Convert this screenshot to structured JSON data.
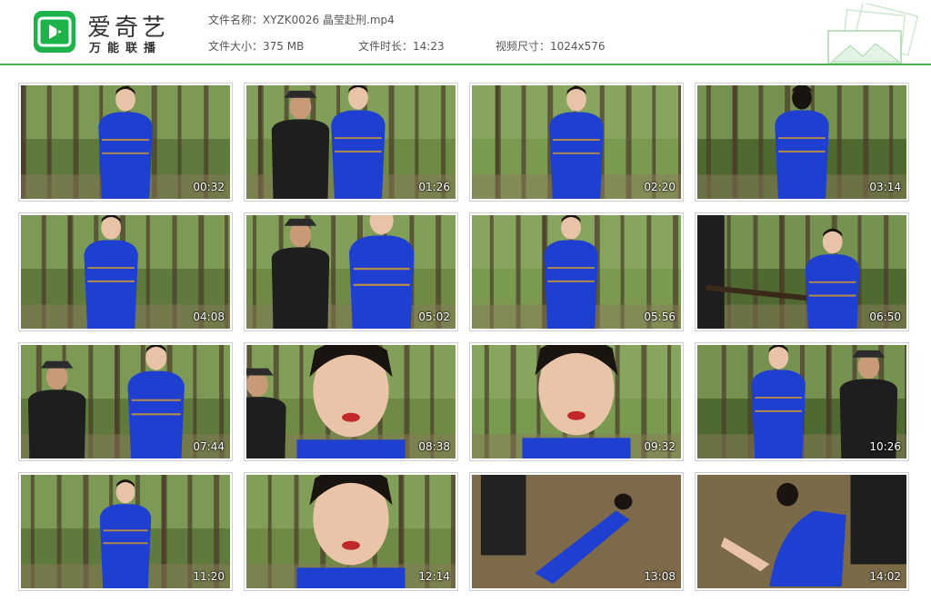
{
  "header": {
    "brand_title": "爱奇艺",
    "brand_subtitle": "万能联播",
    "file_name_label": "文件名称：",
    "file_name": "XYZK0026 晶莹赴刑.mp4",
    "file_size_label": "文件大小：",
    "file_size": "375 MB",
    "duration_label": "文件时长：",
    "duration": "14:23",
    "dimensions_label": "视频尺寸：",
    "dimensions": "1024x576"
  },
  "colors": {
    "accent": "#1db34a",
    "line": "#4caf50",
    "dress": "#1f3fd0"
  },
  "thumbnails": [
    {
      "time": "00:32",
      "scene": "woman-center"
    },
    {
      "time": "01:26",
      "scene": "woman-man-left"
    },
    {
      "time": "02:20",
      "scene": "woman-center"
    },
    {
      "time": "03:14",
      "scene": "woman-back"
    },
    {
      "time": "04:08",
      "scene": "woman-side"
    },
    {
      "time": "05:02",
      "scene": "man-woman-closeup"
    },
    {
      "time": "05:56",
      "scene": "woman-profile"
    },
    {
      "time": "06:50",
      "scene": "rifle-woman"
    },
    {
      "time": "07:44",
      "scene": "man-woman"
    },
    {
      "time": "08:38",
      "scene": "woman-face"
    },
    {
      "time": "09:32",
      "scene": "face-closeup"
    },
    {
      "time": "10:26",
      "scene": "woman-man-right"
    },
    {
      "time": "11:20",
      "scene": "woman-center-far"
    },
    {
      "time": "12:14",
      "scene": "face-closeup"
    },
    {
      "time": "13:08",
      "scene": "woman-lying"
    },
    {
      "time": "14:02",
      "scene": "woman-kneeling"
    }
  ]
}
